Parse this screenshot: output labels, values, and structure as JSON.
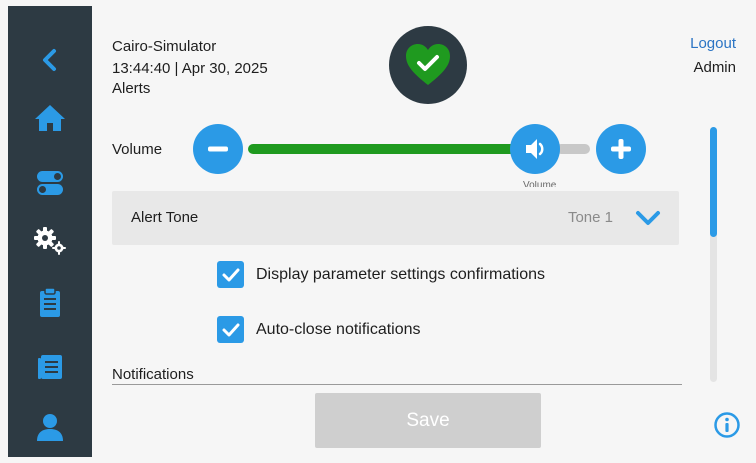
{
  "header": {
    "device_name": "Cairo-Simulator",
    "datetime": "13:44:40 | Apr 30, 2025",
    "page_title": "Alerts",
    "logout_label": "Logout",
    "user_role": "Admin"
  },
  "volume": {
    "label": "Volume",
    "level_fraction": 0.82,
    "subtext": "Volume"
  },
  "alert_tone": {
    "label": "Alert Tone",
    "value": "Tone 1"
  },
  "options": [
    {
      "label": "Display parameter settings confirmations",
      "checked": true
    },
    {
      "label": "Auto-close notifications",
      "checked": true
    }
  ],
  "notifications": {
    "section_title": "Notifications"
  },
  "actions": {
    "save_label": "Save"
  },
  "sidebar": {
    "items": [
      {
        "icon": "back-chevron-icon"
      },
      {
        "icon": "home-icon"
      },
      {
        "icon": "toggles-icon"
      },
      {
        "icon": "settings-gears-icon",
        "selected": true
      },
      {
        "icon": "clipboard-icon"
      },
      {
        "icon": "logbook-icon"
      },
      {
        "icon": "user-icon"
      }
    ]
  },
  "colors": {
    "sidebar": "#2d3a43",
    "accent_blue": "#2b9ae6",
    "link_blue": "#2b74c4",
    "volume_green": "#1f9a1f",
    "status_green": "#1f9a1f",
    "save_disabled": "#cfcfcf"
  }
}
